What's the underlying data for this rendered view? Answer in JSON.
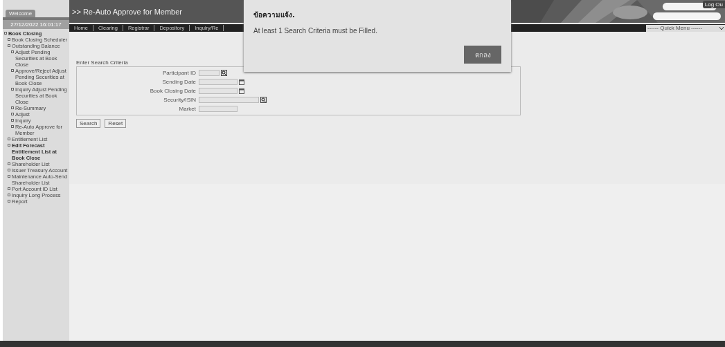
{
  "sidebar": {
    "welcome_tab": "Welcome",
    "datetime": "27/12/2022 16:01:17",
    "tree": [
      {
        "label": "Book Closing",
        "highlighted": true,
        "children": [
          {
            "label": "Book Closing Scheduler",
            "highlighted": false
          },
          {
            "label": "Outstanding Balance",
            "highlighted": false,
            "children": [
              {
                "label": "Adjust Pending Securities at Book Close",
                "highlighted": false
              },
              {
                "label": "Approve/Reject Adjust Pending Securities at Book Close",
                "highlighted": false
              },
              {
                "label": "Inquiry Adjust Pending Securities at Book Close",
                "highlighted": false
              },
              {
                "label": "Re-Summary",
                "highlighted": false
              },
              {
                "label": "Adjust",
                "highlighted": false
              },
              {
                "label": "Inquiry",
                "highlighted": false
              },
              {
                "label": "Re-Auto Approve for Member",
                "highlighted": false
              }
            ]
          },
          {
            "label": "Entitlement List",
            "highlighted": false
          },
          {
            "label": "Edit Forecast Entitlement List at Book Close",
            "highlighted": true
          },
          {
            "label": "Shareholder List",
            "highlighted": false
          },
          {
            "label": "Issuer Treasury Account",
            "highlighted": false
          },
          {
            "label": "Maintenance Auto-Send Shareholder List",
            "highlighted": false
          },
          {
            "label": "Port Account ID List",
            "highlighted": false
          },
          {
            "label": "Inquiry Long Process",
            "highlighted": false
          },
          {
            "label": "Report",
            "highlighted": false
          }
        ]
      }
    ]
  },
  "header": {
    "title": ">> Re-Auto Approve for Member",
    "logout": "Log Ou",
    "menu": [
      {
        "label": "Home"
      },
      {
        "label": "Clearing"
      },
      {
        "label": "Registrar"
      },
      {
        "label": "Depository"
      },
      {
        "label": "Inquiry/Re"
      }
    ],
    "quick_menu": "------ Quick Menu ------"
  },
  "form": {
    "legend": "Enter Search Criteria",
    "fields": [
      {
        "label": "Participant ID",
        "kind": "lookup"
      },
      {
        "label": "Sending Date",
        "kind": "date"
      },
      {
        "label": "Book Closing Date",
        "kind": "date"
      },
      {
        "label": "Security/ISIN",
        "kind": "lookup"
      },
      {
        "label": "Market",
        "kind": "plain"
      }
    ],
    "buttons": [
      "Search",
      "Reset"
    ]
  },
  "dialog": {
    "title": "ข้อความแจ้ง.",
    "message": "At least 1 Search Criteria must be Filled.",
    "button": "ตกลง"
  }
}
